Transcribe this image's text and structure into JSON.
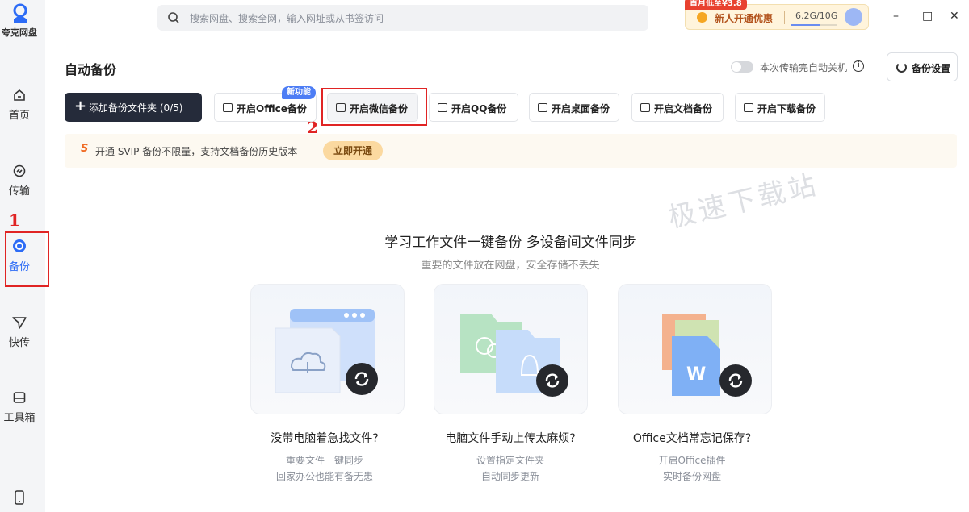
{
  "app": {
    "logo_text": "夸克网盘"
  },
  "sidebar": {
    "items": [
      {
        "label": "首页",
        "icon": "home-icon"
      },
      {
        "label": "传输",
        "icon": "transfer-icon"
      },
      {
        "label": "备份",
        "icon": "backup-icon",
        "active": true
      },
      {
        "label": "快传",
        "icon": "send-icon"
      },
      {
        "label": "工具箱",
        "icon": "toolbox-icon"
      }
    ],
    "bottom_icon": "phone-icon"
  },
  "annotations": {
    "step1": "1",
    "step2": "2"
  },
  "search": {
    "placeholder": "搜索网盘、搜索全网，输入网址或从书签访问"
  },
  "promo": {
    "tag": "首月低至¥3.8",
    "label": "新人开通优惠",
    "storage": "6.2G/10G",
    "storage_used_fraction": 0.62
  },
  "window": {
    "minimize": "–",
    "maximize": "□",
    "close": "✕"
  },
  "main": {
    "title": "自动备份",
    "auto_shutdown_label": "本次传输完自动关机",
    "settings_label": "备份设置",
    "add_folder_label": "添加备份文件夹 (0/5)",
    "new_badge": "新功能",
    "backup_buttons": [
      "开启Office备份",
      "开启微信备份",
      "开启QQ备份",
      "开启桌面备份",
      "开启文档备份",
      "开启下载备份"
    ],
    "banner": {
      "text": "开通 SVIP 备份不限量，支持文档备份历史版本",
      "button": "立即开通"
    },
    "watermark": "极速下载站",
    "hero_title": "学习工作文件一键备份 多设备间文件同步",
    "hero_subtitle": "重要的文件放在网盘，安全存储不丢失",
    "cards": [
      {
        "title": "没带电脑着急找文件?",
        "line1": "重要文件一键同步",
        "line2": "回家办公也能有备无患"
      },
      {
        "title": "电脑文件手动上传太麻烦?",
        "line1": "设置指定文件夹",
        "line2": "自动同步更新"
      },
      {
        "title": "Office文档常忘记保存?",
        "line1": "开启Office插件",
        "line2": "实时备份网盘"
      }
    ]
  },
  "colors": {
    "accent": "#2d6cf6",
    "annotation": "#e02424",
    "dark_button": "#252b3a"
  }
}
